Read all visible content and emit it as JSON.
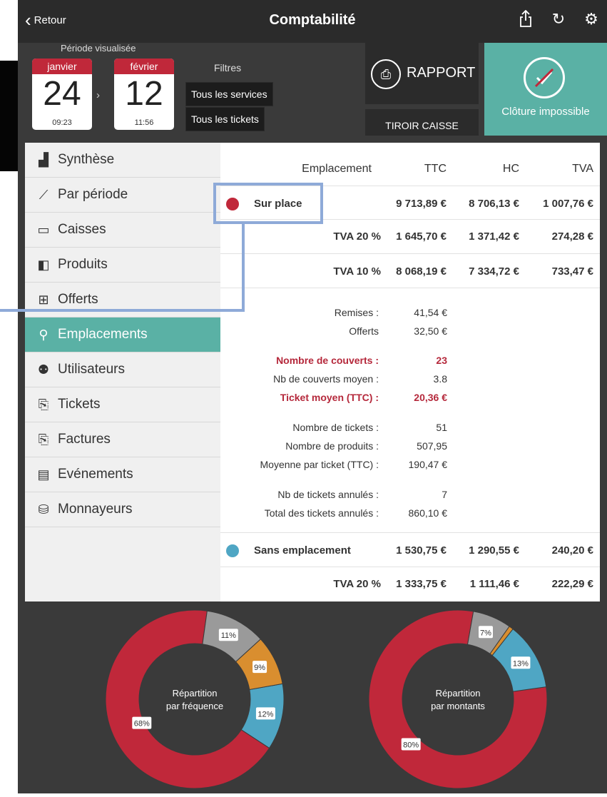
{
  "topbar": {
    "back_label": "Retour",
    "title": "Comptabilité",
    "icons": [
      "share-icon",
      "refresh-icon",
      "gear-icon"
    ]
  },
  "header": {
    "period_label": "Période visualisée",
    "from": {
      "month": "janvier",
      "day": "24",
      "time": "09:23"
    },
    "arrow": "›",
    "to": {
      "month": "février",
      "day": "12",
      "time": "11:56"
    },
    "filters_label": "Filtres",
    "filter_services": "Tous les services",
    "filter_tickets": "Tous les tickets",
    "rapport_label": "RAPPORT",
    "tiroir_label": "TIROIR CAISSE",
    "cloture_label": "Clôture impossible"
  },
  "sidebar": {
    "items": [
      {
        "label": "Synthèse",
        "icon": "bar-chart-icon"
      },
      {
        "label": "Par période",
        "icon": "line-chart-icon"
      },
      {
        "label": "Caisses",
        "icon": "register-icon"
      },
      {
        "label": "Produits",
        "icon": "products-icon"
      },
      {
        "label": "Offerts",
        "icon": "gift-icon"
      },
      {
        "label": "Emplacements",
        "icon": "location-pin-icon"
      },
      {
        "label": "Utilisateurs",
        "icon": "users-icon"
      },
      {
        "label": "Tickets",
        "icon": "ticket-icon"
      },
      {
        "label": "Factures",
        "icon": "invoice-icon"
      },
      {
        "label": "Evénements",
        "icon": "events-icon"
      },
      {
        "label": "Monnayeurs",
        "icon": "coin-changer-icon"
      }
    ],
    "active": "Emplacements"
  },
  "table": {
    "headers": {
      "emplacement": "Emplacement",
      "ttc": "TTC",
      "hc": "HC",
      "tva": "TVA"
    },
    "sur_place": {
      "name": "Sur place",
      "ttc": "9 713,89 €",
      "hc": "8 706,13 €",
      "tva": "1 007,76 €",
      "color": "#c0283a"
    },
    "sur_place_tva20": {
      "label": "TVA 20 %",
      "ttc": "1 645,70 €",
      "hc": "1 371,42 €",
      "tva": "274,28 €"
    },
    "sur_place_tva10": {
      "label": "TVA 10 %",
      "ttc": "8 068,19 €",
      "hc": "7 334,72 €",
      "tva": "733,47 €"
    },
    "stats": {
      "remises_l": "Remises :",
      "remises_v": "41,54 €",
      "offerts_l": "Offerts",
      "offerts_v": "32,50 €",
      "couverts_l": "Nombre de couverts :",
      "couverts_v": "23",
      "couverts_moy_l": "Nb de couverts moyen :",
      "couverts_moy_v": "3.8",
      "ticket_moy_l": "Ticket moyen (TTC) :",
      "ticket_moy_v": "20,36 €",
      "nb_tickets_l": "Nombre de tickets :",
      "nb_tickets_v": "51",
      "nb_produits_l": "Nombre de produits :",
      "nb_produits_v": "507,95",
      "moy_ticket_l": "Moyenne par ticket (TTC) :",
      "moy_ticket_v": "190,47 €",
      "annules_l": "Nb de tickets annulés :",
      "annules_v": "7",
      "total_annules_l": "Total des tickets annulés :",
      "total_annules_v": "860,10 €"
    },
    "sans_empl": {
      "name": "Sans emplacement",
      "ttc": "1 530,75 €",
      "hc": "1 290,55 €",
      "tva": "240,20 €",
      "color": "#4fa6c4"
    },
    "sans_empl_tva20": {
      "label": "TVA 20 %",
      "ttc": "1 333,75 €",
      "hc": "1 111,46 €",
      "tva": "222,29 €"
    }
  },
  "charts": {
    "freq": {
      "title1": "Répartition",
      "title2": "par fréquence",
      "slices": [
        {
          "label": "68%",
          "value": 68,
          "color": "#c0283a"
        },
        {
          "label": "11%",
          "value": 11,
          "color": "#9a9a9a"
        },
        {
          "label": "9%",
          "value": 9,
          "color": "#d98e2f"
        },
        {
          "label": "12%",
          "value": 12,
          "color": "#4fa6c4"
        }
      ]
    },
    "amount": {
      "title1": "Répartition",
      "title2": "par montants",
      "slices": [
        {
          "label": "80%",
          "value": 80,
          "color": "#c0283a"
        },
        {
          "label": "7%",
          "value": 7,
          "color": "#9a9a9a"
        },
        {
          "label": "",
          "value": 0.8,
          "color": "#d98e2f"
        },
        {
          "label": "13%",
          "value": 12.2,
          "color": "#4fa6c4"
        }
      ]
    }
  }
}
